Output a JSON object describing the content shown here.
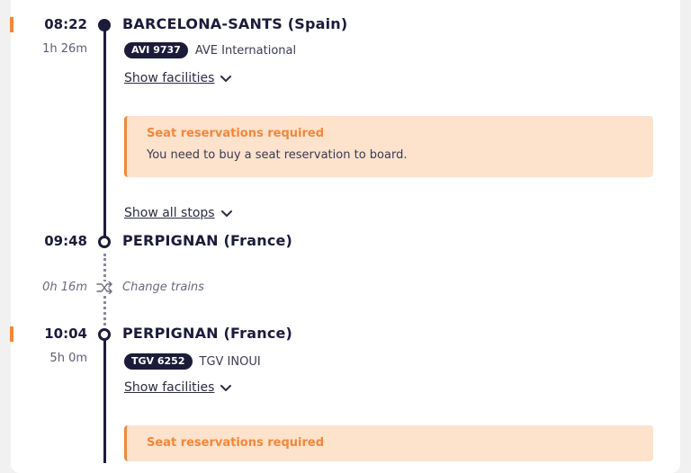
{
  "segments": [
    {
      "departure_time": "08:22",
      "duration": "1h 26m",
      "origin": "BARCELONA-SANTS (Spain)",
      "train_number": "AVI 9737",
      "train_name": "AVE International",
      "facilities_link": "Show facilities",
      "notice_title": "Seat reservations required",
      "notice_text": "You need to buy a seat reservation to board.",
      "stops_link": "Show all stops",
      "arrival_time": "09:48",
      "destination": "PERPIGNAN (France)"
    },
    {
      "departure_time": "10:04",
      "duration": "5h 0m",
      "origin": "PERPIGNAN (France)",
      "train_number": "TGV 6252",
      "train_name": "TGV INOUI",
      "facilities_link": "Show facilities",
      "notice_title": "Seat reservations required"
    }
  ],
  "transfer": {
    "duration": "0h 16m",
    "label": "Change trains",
    "icon": "shuffle-icon"
  },
  "colors": {
    "accent": "#f0883b",
    "notice_bg": "#fde2cc",
    "primary": "#1c1b3a"
  }
}
